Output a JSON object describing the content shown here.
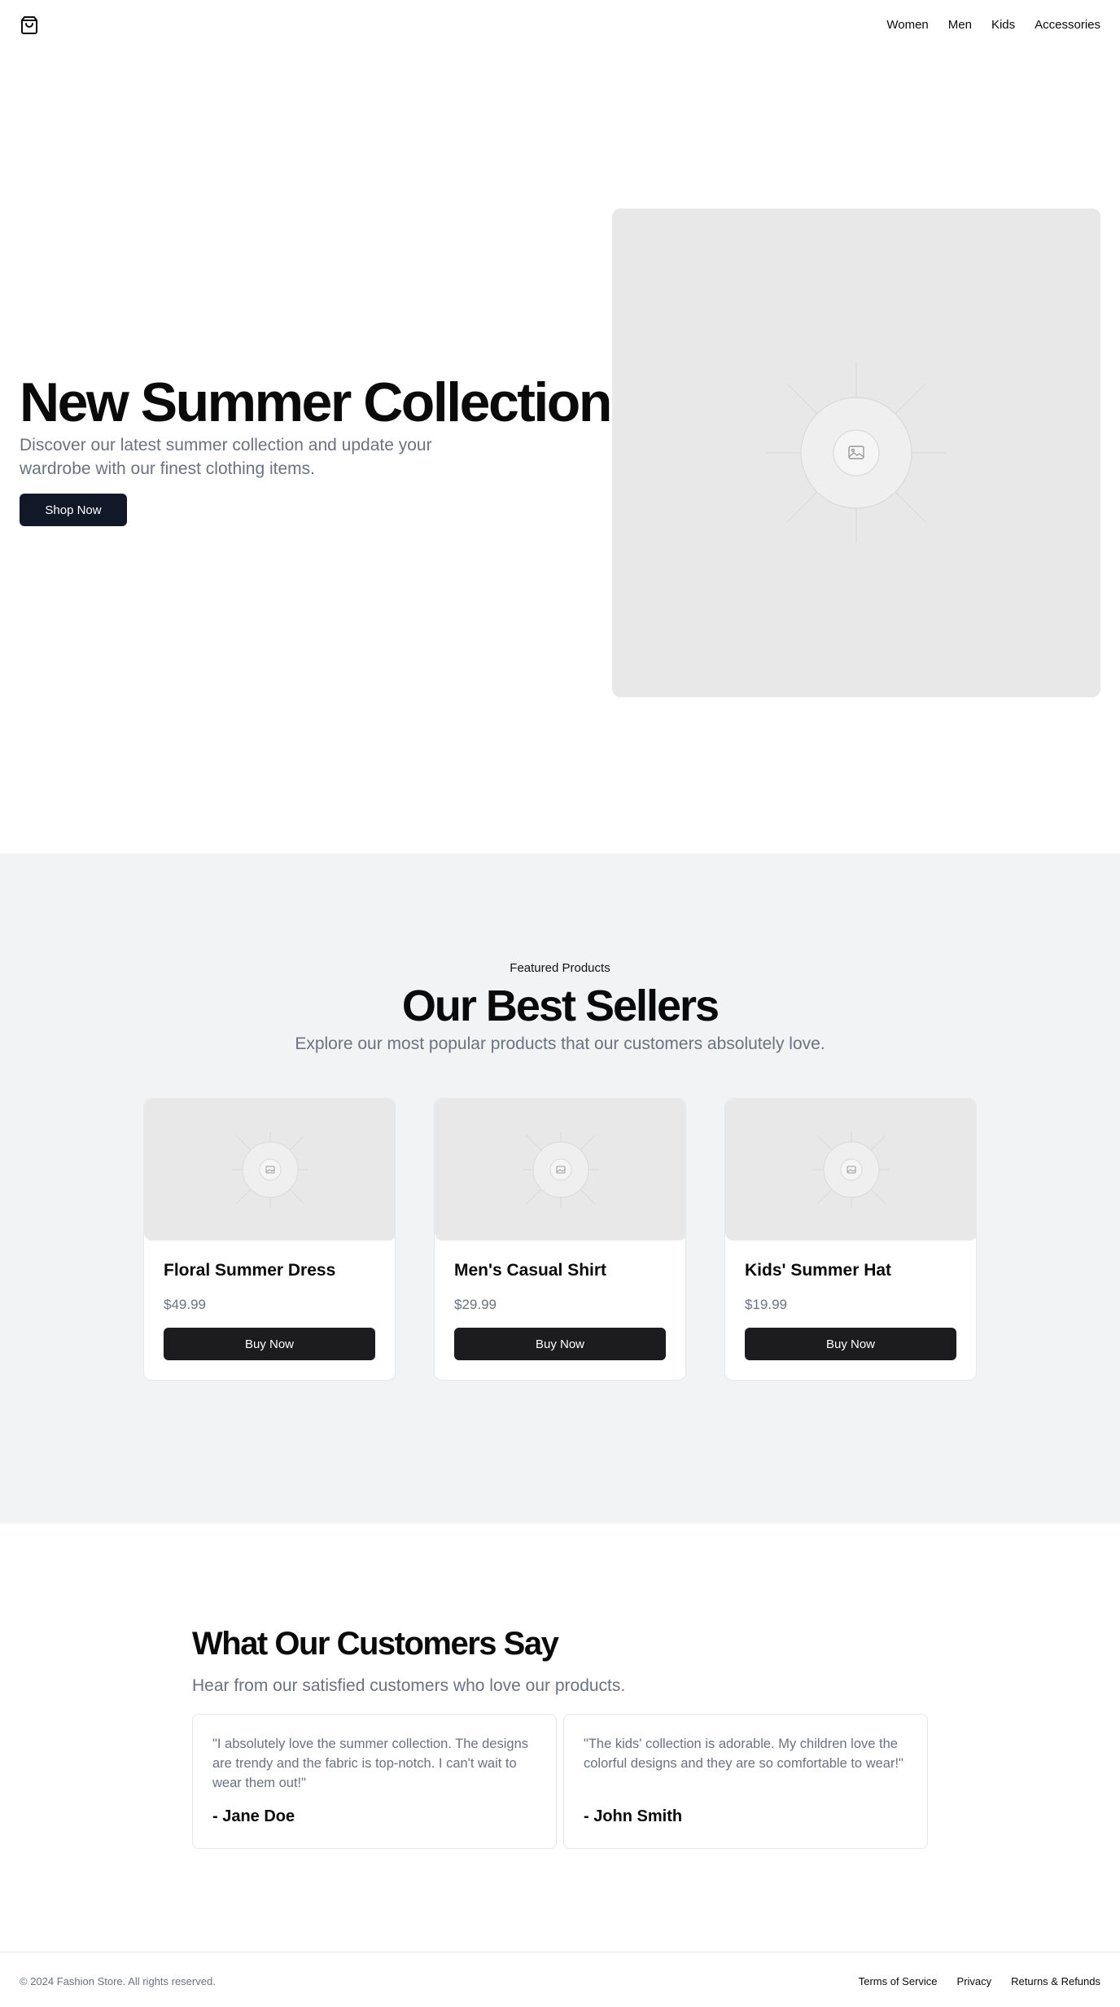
{
  "header": {
    "logo_icon": "shopping-bag-icon",
    "nav": [
      "Women",
      "Men",
      "Kids",
      "Accessories"
    ]
  },
  "hero": {
    "title": "New Summer Collection",
    "subtitle": "Discover our latest summer collection and update your wardrobe with our finest clothing items.",
    "cta": "Shop Now",
    "image_icon": "image-placeholder-icon"
  },
  "featured": {
    "eyebrow": "Featured Products",
    "title": "Our Best Sellers",
    "subtitle": "Explore our most popular products that our customers absolutely love.",
    "products": [
      {
        "name": "Floral Summer Dress",
        "price": "$49.99",
        "button": "Buy Now"
      },
      {
        "name": "Men's Casual Shirt",
        "price": "$29.99",
        "button": "Buy Now"
      },
      {
        "name": "Kids' Summer Hat",
        "price": "$19.99",
        "button": "Buy Now"
      }
    ]
  },
  "testimonials": {
    "title": "What Our Customers Say",
    "subtitle": "Hear from our satisfied customers who love our products.",
    "items": [
      {
        "quote": "\"I absolutely love the summer collection. The designs are trendy and the fabric is top-notch. I can't wait to wear them out!\"",
        "author": "- Jane Doe"
      },
      {
        "quote": "\"The kids' collection is adorable. My children love the colorful designs and they are so comfortable to wear!\"",
        "author": "- John Smith"
      }
    ]
  },
  "footer": {
    "copyright": "© 2024 Fashion Store. All rights reserved.",
    "links": [
      "Terms of Service",
      "Privacy",
      "Returns & Refunds"
    ]
  },
  "colors": {
    "primary_button": "#111827",
    "section_bg": "#f2f3f5",
    "placeholder_bg": "#e8e8e8",
    "muted_text": "#6b7280"
  }
}
